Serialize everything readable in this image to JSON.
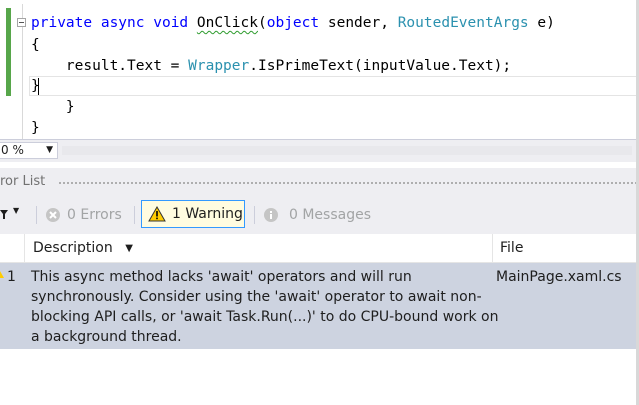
{
  "editor": {
    "lines": {
      "signature": {
        "kw1": "private",
        "kw2": "async",
        "kw3": "void",
        "method": "OnClick",
        "open": "(",
        "kw4": "object",
        "param1": " sender, ",
        "type1": "RoutedEventArgs",
        "param2": " e)"
      },
      "open_brace": "{",
      "statement": {
        "lhs": "    result.Text = ",
        "type": "Wrapper",
        "rhs": ".IsPrimeText(inputValue.Text);"
      },
      "close_brace": "}",
      "outer_close_1": "    }",
      "outer_close_2": "}"
    }
  },
  "zoom": {
    "value": "0 %"
  },
  "error_list": {
    "title": "ror List",
    "toolbar": {
      "errors": "0 Errors",
      "warnings": "1 Warning",
      "messages": "0 Messages"
    },
    "columns": {
      "description": "Description",
      "file": "File"
    },
    "rows": [
      {
        "index": "1",
        "description_lines": [
          "This async method lacks 'await' operators and will run",
          "synchronously. Consider using the 'await' operator to await non-",
          "blocking API calls, or 'await Task.Run(...)' to do CPU-bound work on",
          "a background thread."
        ],
        "file": "MainPage.xaml.cs"
      }
    ]
  },
  "colors": {
    "keyword": "#0000ff",
    "type": "#2b91af",
    "change_bar": "#57a64a",
    "selected_row": "#cdd3e0",
    "warning_highlight": "#fffce0"
  },
  "icons": [
    "filter-icon",
    "error-icon",
    "warning-icon",
    "info-icon",
    "sort-arrow-icon",
    "warning-row-icon"
  ]
}
